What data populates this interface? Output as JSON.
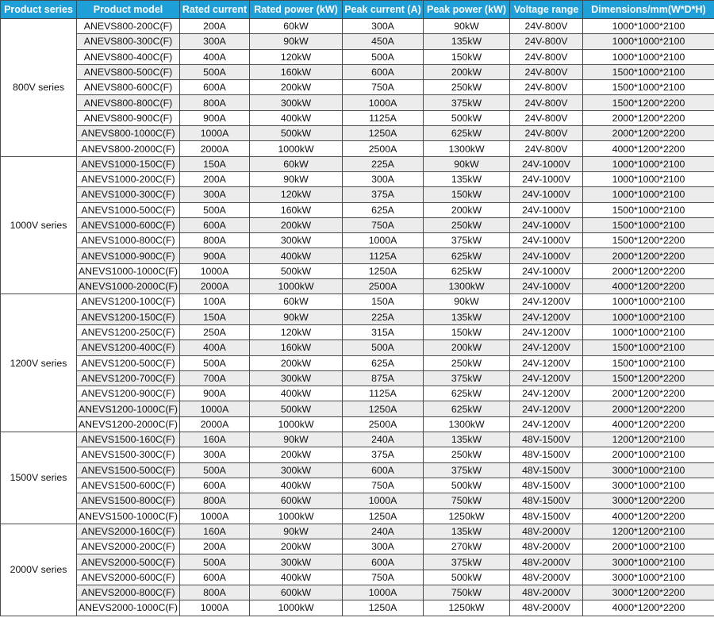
{
  "columns": [
    "Product series",
    "Product model",
    "Rated current",
    "Rated power (kW)",
    "Peak current (A)",
    "Peak power (kW)",
    "Voltage range",
    "Dimensions/mm(W*D*H)"
  ],
  "groups": [
    {
      "series": "800V series",
      "rows": [
        [
          "ANEVS800-200C(F)",
          "200A",
          "60kW",
          "300A",
          "90kW",
          "24V-800V",
          "1000*1000*2100"
        ],
        [
          "ANEVS800-300C(F)",
          "300A",
          "90kW",
          "450A",
          "135kW",
          "24V-800V",
          "1000*1000*2100"
        ],
        [
          "ANEVS800-400C(F)",
          "400A",
          "120kW",
          "500A",
          "150kW",
          "24V-800V",
          "1000*1000*2100"
        ],
        [
          "ANEVS800-500C(F)",
          "500A",
          "160kW",
          "600A",
          "200kW",
          "24V-800V",
          "1500*1000*2100"
        ],
        [
          "ANEVS800-600C(F)",
          "600A",
          "200kW",
          "750A",
          "250kW",
          "24V-800V",
          "1500*1000*2100"
        ],
        [
          "ANEVS800-800C(F)",
          "800A",
          "300kW",
          "1000A",
          "375kW",
          "24V-800V",
          "1500*1200*2200"
        ],
        [
          "ANEVS800-900C(F)",
          "900A",
          "400kW",
          "1125A",
          "500kW",
          "24V-800V",
          "2000*1200*2200"
        ],
        [
          "ANEVS800-1000C(F)",
          "1000A",
          "500kW",
          "1250A",
          "625kW",
          "24V-800V",
          "2000*1200*2200"
        ],
        [
          "ANEVS800-2000C(F)",
          "2000A",
          "1000kW",
          "2500A",
          "1300kW",
          "24V-800V",
          "4000*1200*2200"
        ]
      ]
    },
    {
      "series": "1000V series",
      "rows": [
        [
          "ANEVS1000-150C(F)",
          "150A",
          "60kW",
          "225A",
          "90kW",
          "24V-1000V",
          "1000*1000*2100"
        ],
        [
          "ANEVS1000-200C(F)",
          "200A",
          "90kW",
          "300A",
          "135kW",
          "24V-1000V",
          "1000*1000*2100"
        ],
        [
          "ANEVS1000-300C(F)",
          "300A",
          "120kW",
          "375A",
          "150kW",
          "24V-1000V",
          "1000*1000*2100"
        ],
        [
          "ANEVS1000-500C(F)",
          "500A",
          "160kW",
          "625A",
          "200kW",
          "24V-1000V",
          "1500*1000*2100"
        ],
        [
          "ANEVS1000-600C(F)",
          "600A",
          "200kW",
          "750A",
          "250kW",
          "24V-1000V",
          "1500*1000*2100"
        ],
        [
          "ANEVS1000-800C(F)",
          "800A",
          "300kW",
          "1000A",
          "375kW",
          "24V-1000V",
          "1500*1200*2200"
        ],
        [
          "ANEVS1000-900C(F)",
          "900A",
          "400kW",
          "1125A",
          "625kW",
          "24V-1000V",
          "2000*1200*2200"
        ],
        [
          "ANEVS1000-1000C(F)",
          "1000A",
          "500kW",
          "1250A",
          "625kW",
          "24V-1000V",
          "2000*1200*2200"
        ],
        [
          "ANEVS1000-2000C(F)",
          "2000A",
          "1000kW",
          "2500A",
          "1300kW",
          "24V-1000V",
          "4000*1200*2200"
        ]
      ]
    },
    {
      "series": "1200V series",
      "rows": [
        [
          "ANEVS1200-100C(F)",
          "100A",
          "60kW",
          "150A",
          "90kW",
          "24V-1200V",
          "1000*1000*2100"
        ],
        [
          "ANEVS1200-150C(F)",
          "150A",
          "90kW",
          "225A",
          "135kW",
          "24V-1200V",
          "1000*1000*2100"
        ],
        [
          "ANEVS1200-250C(F)",
          "250A",
          "120kW",
          "315A",
          "150kW",
          "24V-1200V",
          "1000*1000*2100"
        ],
        [
          "ANEVS1200-400C(F)",
          "400A",
          "160kW",
          "500A",
          "200kW",
          "24V-1200V",
          "1500*1000*2100"
        ],
        [
          "ANEVS1200-500C(F)",
          "500A",
          "200kW",
          "625A",
          "250kW",
          "24V-1200V",
          "1500*1000*2100"
        ],
        [
          "ANEVS1200-700C(F)",
          "700A",
          "300kW",
          "875A",
          "375kW",
          "24V-1200V",
          "1500*1200*2200"
        ],
        [
          "ANEVS1200-900C(F)",
          "900A",
          "400kW",
          "1125A",
          "625kW",
          "24V-1200V",
          "2000*1200*2200"
        ],
        [
          "ANEVS1200-1000C(F)",
          "1000A",
          "500kW",
          "1250A",
          "625kW",
          "24V-1200V",
          "2000*1200*2200"
        ],
        [
          "ANEVS1200-2000C(F)",
          "2000A",
          "1000kW",
          "2500A",
          "1300kW",
          "24V-1200V",
          "4000*1200*2200"
        ]
      ]
    },
    {
      "series": "1500V series",
      "rows": [
        [
          "ANEVS1500-160C(F)",
          "160A",
          "90kW",
          "240A",
          "135kW",
          "48V-1500V",
          "1200*1200*2100"
        ],
        [
          "ANEVS1500-300C(F)",
          "300A",
          "200kW",
          "375A",
          "250kW",
          "48V-1500V",
          "2000*1000*2100"
        ],
        [
          "ANEVS1500-500C(F)",
          "500A",
          "300kW",
          "600A",
          "375kW",
          "48V-1500V",
          "3000*1000*2100"
        ],
        [
          "ANEVS1500-600C(F)",
          "600A",
          "400kW",
          "750A",
          "500kW",
          "48V-1500V",
          "3000*1000*2100"
        ],
        [
          "ANEVS1500-800C(F)",
          "800A",
          "600kW",
          "1000A",
          "750kW",
          "48V-1500V",
          "3000*1200*2200"
        ],
        [
          "ANEVS1500-1000C(F)",
          "1000A",
          "1000kW",
          "1250A",
          "1250kW",
          "48V-1500V",
          "4000*1200*2200"
        ]
      ]
    },
    {
      "series": "2000V series",
      "rows": [
        [
          "ANEVS2000-160C(F)",
          "160A",
          "90kW",
          "240A",
          "135kW",
          "48V-2000V",
          "1200*1200*2100"
        ],
        [
          "ANEVS2000-200C(F)",
          "200A",
          "200kW",
          "300A",
          "270kW",
          "48V-2000V",
          "2000*1000*2100"
        ],
        [
          "ANEVS2000-500C(F)",
          "500A",
          "300kW",
          "600A",
          "375kW",
          "48V-2000V",
          "3000*1000*2100"
        ],
        [
          "ANEVS2000-600C(F)",
          "600A",
          "400kW",
          "750A",
          "500kW",
          "48V-2000V",
          "3000*1000*2100"
        ],
        [
          "ANEVS2000-800C(F)",
          "800A",
          "600kW",
          "1000A",
          "750kW",
          "48V-2000V",
          "3000*1200*2200"
        ],
        [
          "ANEVS2000-1000C(F)",
          "1000A",
          "1000kW",
          "1250A",
          "1250kW",
          "48V-2000V",
          "4000*1200*2200"
        ]
      ]
    }
  ]
}
